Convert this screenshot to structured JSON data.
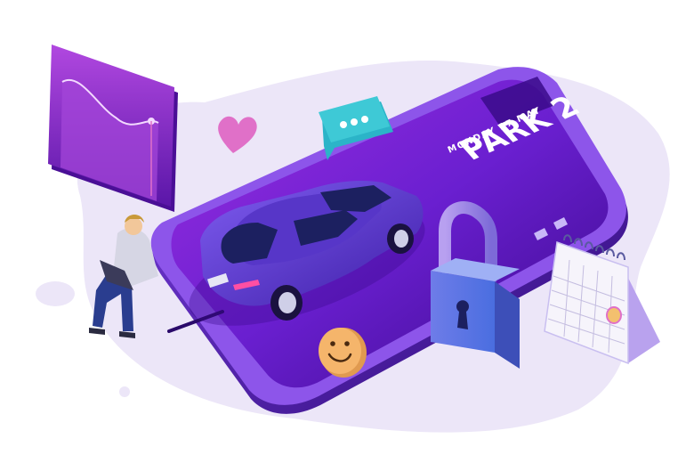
{
  "phone": {
    "date_text": "MONDAY 17 MAY",
    "title_text": "PARK 2"
  },
  "icons": {
    "chat_bubble": "chat-bubble-icon",
    "heart": "heart-icon",
    "smiley": "smiley-icon",
    "padlock": "padlock-icon",
    "calendar": "calendar-icon",
    "chart_card": "line-chart-card-icon"
  },
  "colors": {
    "primary_purple": "#6a1fd0",
    "deep_purple": "#3a0a8a",
    "lavender_bg": "#ece6f8",
    "accent_cyan": "#3ec9d6",
    "lock_blue": "#5d83e6",
    "accent_pink": "#e070c8",
    "smiley_orange": "#f5b56b"
  }
}
